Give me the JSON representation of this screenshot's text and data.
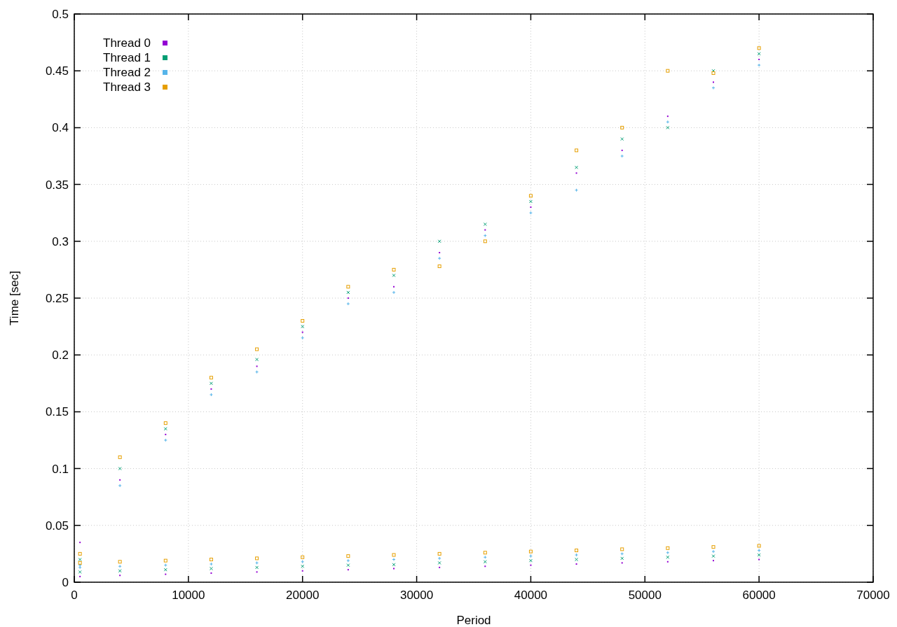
{
  "chart_data": {
    "type": "scatter",
    "xlabel": "Period",
    "ylabel": "Time [sec]",
    "xlim": [
      0,
      70000
    ],
    "ylim": [
      0,
      0.5
    ],
    "grid": true,
    "legend": true,
    "xticks": [
      0,
      10000,
      20000,
      30000,
      40000,
      50000,
      60000,
      70000
    ],
    "yticks": [
      0,
      0.05,
      0.1,
      0.15,
      0.2,
      0.25,
      0.3,
      0.35,
      0.4,
      0.45,
      0.5
    ],
    "x": [
      500,
      4000,
      8000,
      12000,
      16000,
      20000,
      24000,
      28000,
      32000,
      36000,
      40000,
      44000,
      48000,
      52000,
      56000,
      60000,
      500,
      4000,
      8000,
      12000,
      16000,
      20000,
      24000,
      28000,
      32000,
      36000,
      40000,
      44000,
      48000,
      52000,
      56000,
      60000
    ],
    "series": [
      {
        "name": "Thread 0",
        "color": "#9400d3",
        "values": [
          0.035,
          0.09,
          0.13,
          0.17,
          0.19,
          0.22,
          0.25,
          0.26,
          0.29,
          0.31,
          0.33,
          0.36,
          0.38,
          0.41,
          0.44,
          0.46,
          0.005,
          0.006,
          0.007,
          0.008,
          0.009,
          0.01,
          0.011,
          0.012,
          0.013,
          0.014,
          0.015,
          0.016,
          0.017,
          0.018,
          0.019,
          0.02
        ]
      },
      {
        "name": "Thread 1",
        "color": "#009e73",
        "values": [
          0.02,
          0.1,
          0.135,
          0.175,
          0.196,
          0.225,
          0.255,
          0.27,
          0.3,
          0.315,
          0.335,
          0.365,
          0.39,
          0.4,
          0.45,
          0.465,
          0.009,
          0.01,
          0.011,
          0.012,
          0.013,
          0.014,
          0.015,
          0.0155,
          0.017,
          0.018,
          0.019,
          0.02,
          0.021,
          0.022,
          0.023,
          0.024
        ]
      },
      {
        "name": "Thread 2",
        "color": "#56b4e9",
        "values": [
          0.015,
          0.085,
          0.125,
          0.165,
          0.185,
          0.215,
          0.245,
          0.255,
          0.285,
          0.305,
          0.325,
          0.345,
          0.375,
          0.405,
          0.435,
          0.455,
          0.013,
          0.014,
          0.015,
          0.016,
          0.017,
          0.018,
          0.019,
          0.02,
          0.021,
          0.022,
          0.023,
          0.024,
          0.025,
          0.026,
          0.027,
          0.028
        ]
      },
      {
        "name": "Thread 3",
        "color": "#e69f00",
        "values": [
          0.025,
          0.11,
          0.14,
          0.18,
          0.205,
          0.23,
          0.26,
          0.275,
          0.278,
          0.3,
          0.34,
          0.38,
          0.4,
          0.45,
          0.448,
          0.47,
          0.017,
          0.018,
          0.019,
          0.02,
          0.021,
          0.022,
          0.023,
          0.024,
          0.025,
          0.026,
          0.027,
          0.028,
          0.029,
          0.03,
          0.031,
          0.032
        ]
      }
    ]
  }
}
